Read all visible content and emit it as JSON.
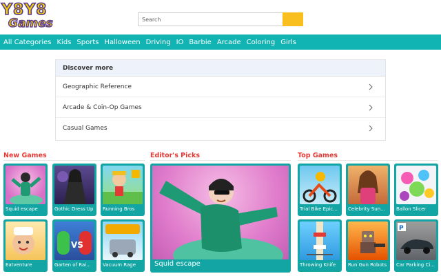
{
  "header": {
    "logo_top": "Y8Y8",
    "logo_bottom": "Games",
    "search_placeholder": "Search"
  },
  "nav": {
    "items": [
      "All Categories",
      "Kids",
      "Sports",
      "Halloween",
      "Driving",
      "IO",
      "Barbie",
      "Arcade",
      "Coloring",
      "Girls"
    ]
  },
  "discover": {
    "title": "Discover more",
    "items": [
      "Geographic Reference",
      "Arcade & Coin-Op Games",
      "Casual Games"
    ]
  },
  "sections": {
    "new_games": {
      "title": "New Games",
      "games": [
        "Squid escape",
        "Gothic Dress Up",
        "Running Bros",
        "Eatventure",
        "Garten of Rai...",
        "Vacuum Rage"
      ]
    },
    "editors_picks": {
      "title": "Editor's Picks",
      "featured": "Squid escape"
    },
    "top_games": {
      "title": "Top Games",
      "games": [
        "Trial Bike Epic...",
        "Celebrity Sun...",
        "Ballon Slicer",
        "Throwing Knife",
        "Run Gun Robots",
        "Car Parking Ci..."
      ]
    }
  },
  "colors": {
    "teal": "#12b3b3",
    "tile_teal": "#13a5a3",
    "section_red": "#e53935",
    "search_button": "#f9bf1e",
    "logo_yellow": "#f5d000",
    "logo_purple": "#5a3d91"
  }
}
